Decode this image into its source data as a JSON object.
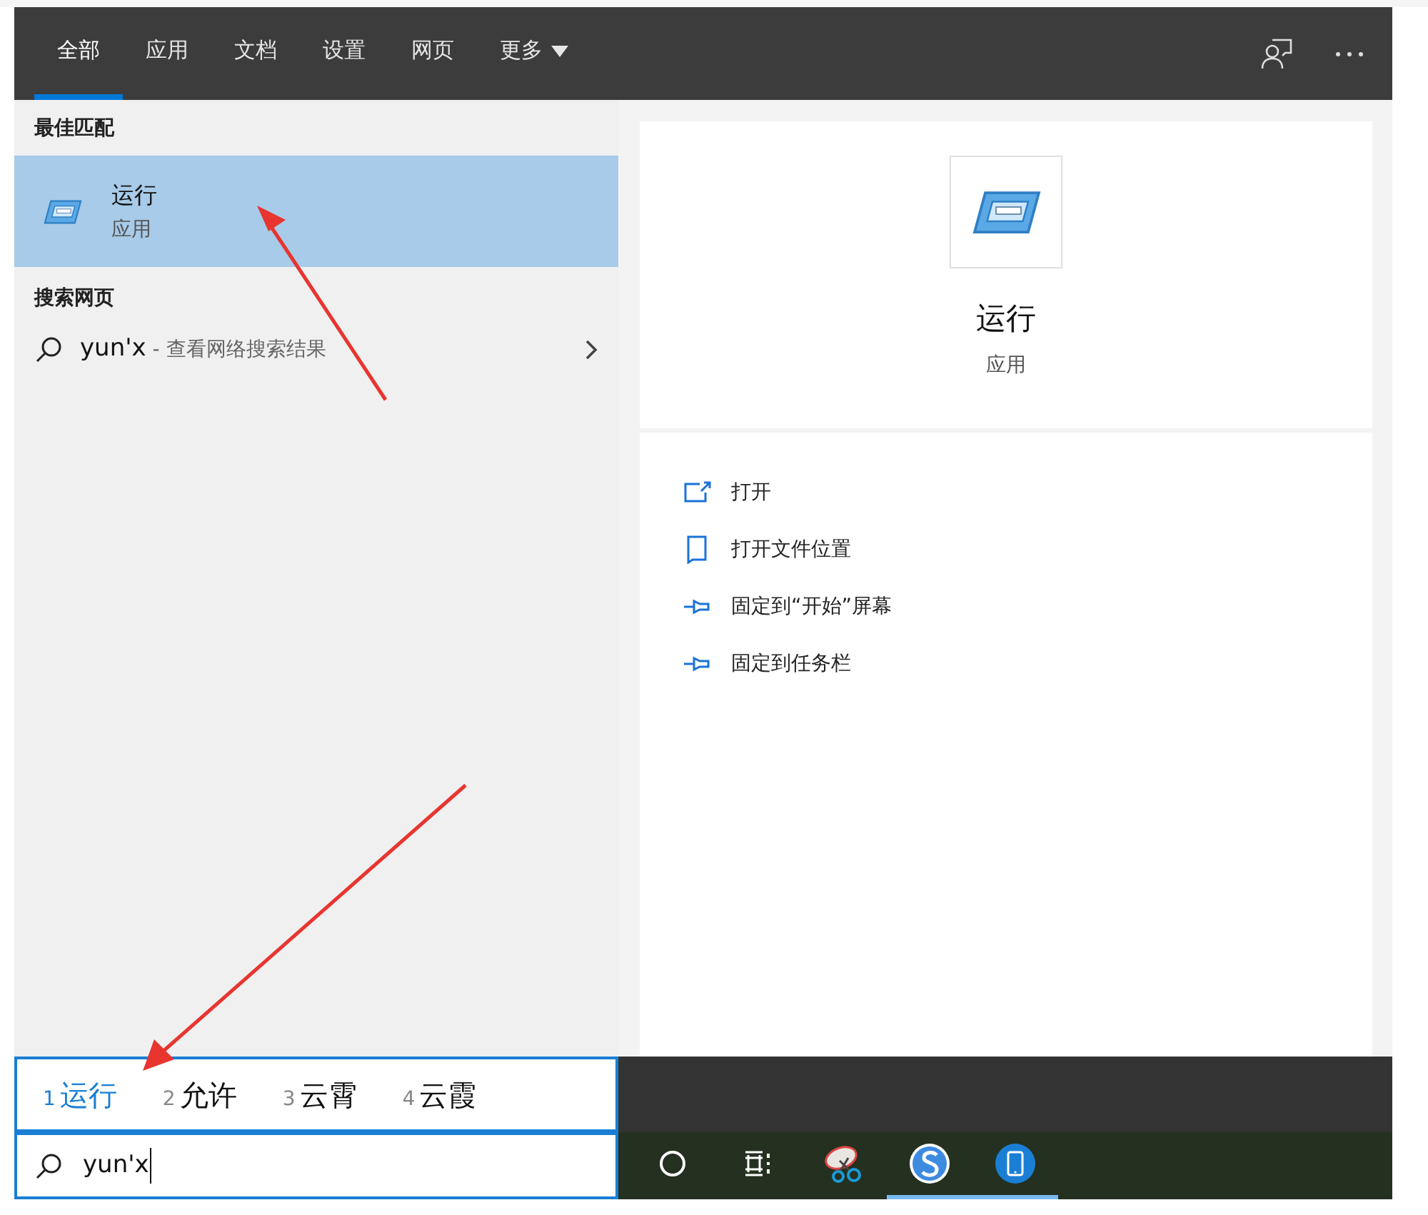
{
  "tabs": [
    {
      "label": "全部",
      "selected": true
    },
    {
      "label": "应用",
      "selected": false
    },
    {
      "label": "文档",
      "selected": false
    },
    {
      "label": "设置",
      "selected": false
    },
    {
      "label": "网页",
      "selected": false
    },
    {
      "label": "更多",
      "selected": false,
      "dropdown": true
    }
  ],
  "best_match": {
    "heading": "最佳匹配",
    "title": "运行",
    "subtitle": "应用",
    "selected": true
  },
  "web_search": {
    "heading": "搜索网页",
    "query": "yun'x",
    "suffix": " - 查看网络搜索结果"
  },
  "preview": {
    "title": "运行",
    "subtitle": "应用"
  },
  "actions": [
    {
      "kind": "open",
      "label": "打开"
    },
    {
      "kind": "folder",
      "label": "打开文件位置"
    },
    {
      "kind": "pin",
      "label": "固定到“开始”屏幕"
    },
    {
      "kind": "pin",
      "label": "固定到任务栏"
    }
  ],
  "candidates": [
    {
      "number": "1",
      "text": "运行",
      "selected": true
    },
    {
      "number": "2",
      "text": "允许",
      "selected": false
    },
    {
      "number": "3",
      "text": "云霄",
      "selected": false
    },
    {
      "number": "4",
      "text": "云霞",
      "selected": false
    }
  ],
  "search_box": {
    "value": "yun'x"
  },
  "taskbar": [
    {
      "kind": "cortana",
      "running": false
    },
    {
      "kind": "taskview",
      "running": false
    },
    {
      "kind": "snip",
      "running": false
    },
    {
      "kind": "browser",
      "running": true
    },
    {
      "kind": "phone",
      "running": true
    }
  ]
}
